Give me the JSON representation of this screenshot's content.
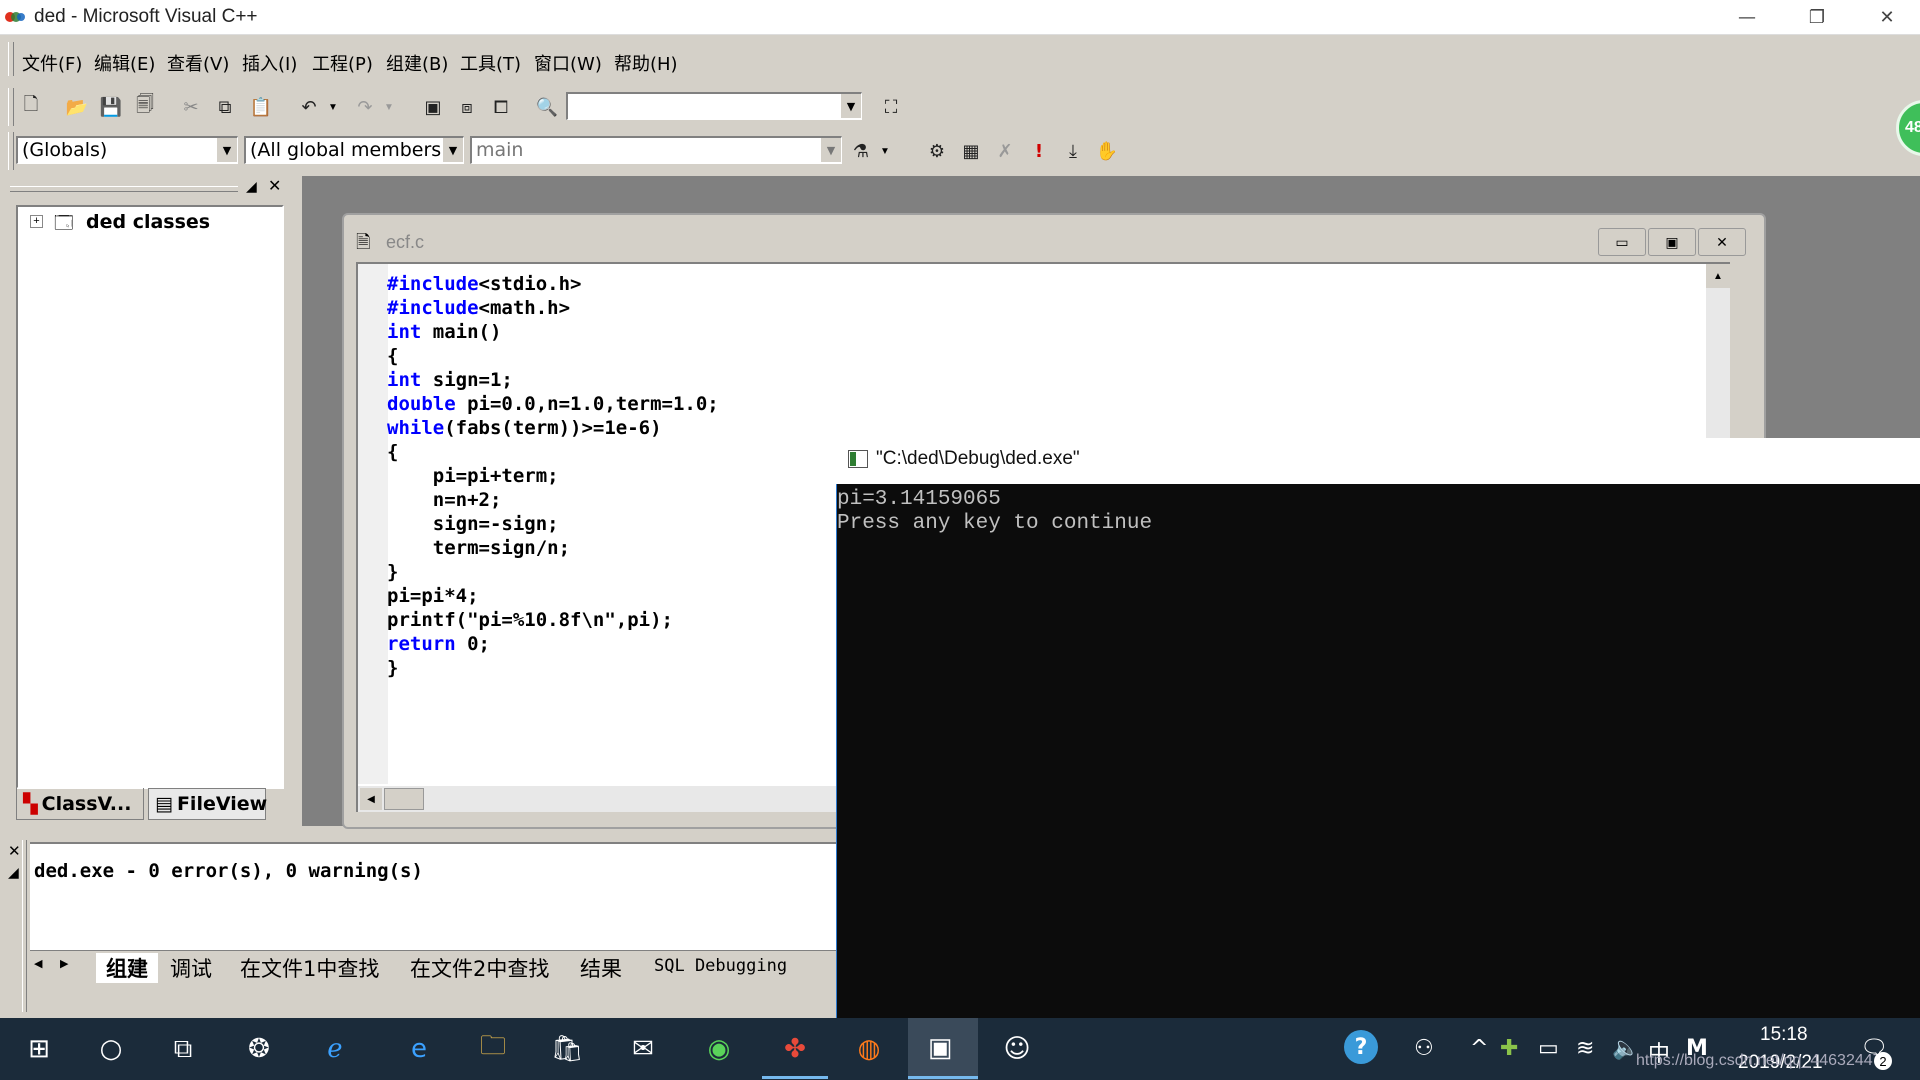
{
  "window": {
    "title": "ded - Microsoft Visual C++",
    "minimize_icon": "—",
    "restore_icon": "❐",
    "close_icon": "✕"
  },
  "menu": [
    "文件(F)",
    "编辑(E)",
    "查看(V)",
    "插入(I)",
    "工程(P)",
    "组建(B)",
    "工具(T)",
    "窗口(W)",
    "帮助(H)"
  ],
  "toolbar": {
    "find_combo_value": "",
    "scope_combo": "(Globals)",
    "members_combo": "(All global members",
    "function_combo": "main"
  },
  "workspace": {
    "tree_root": "ded classes",
    "tabs": [
      "ClassV...",
      "FileView"
    ]
  },
  "editor": {
    "title": "ecf.c",
    "lines": [
      {
        "kw": "#include",
        "rest": "<stdio.h>"
      },
      {
        "kw": "#include",
        "rest": "<math.h>"
      },
      {
        "kw": "int",
        "rest": " main()"
      },
      {
        "kw": "",
        "rest": "{"
      },
      {
        "kw": "int",
        "rest": " sign=1;"
      },
      {
        "kw": "double",
        "rest": " pi=0.0,n=1.0,term=1.0;"
      },
      {
        "kw": "while",
        "rest": "(fabs(term))>=1e-6)"
      },
      {
        "kw": "",
        "rest": "{"
      },
      {
        "kw": "",
        "rest": "    pi=pi+term;"
      },
      {
        "kw": "",
        "rest": "    n=n+2;"
      },
      {
        "kw": "",
        "rest": "    sign=-sign;"
      },
      {
        "kw": "",
        "rest": "    term=sign/n;"
      },
      {
        "kw": "",
        "rest": "}"
      },
      {
        "kw": "",
        "rest": "pi=pi*4;"
      },
      {
        "kw": "",
        "rest": "printf(\"pi=%10.8f\\n\",pi);"
      },
      {
        "kw": "return",
        "rest": " 0;"
      },
      {
        "kw": "",
        "rest": "}"
      }
    ]
  },
  "console": {
    "title": "\"C:\\ded\\Debug\\ded.exe\"",
    "lines": [
      "pi=3.14159065",
      "Press any key to continue"
    ]
  },
  "output": {
    "text": "ded.exe - 0 error(s), 0 warning(s)",
    "tabs": [
      "组建",
      "调试",
      "在文件1中查找",
      "在文件2中查找",
      "结果",
      "SQL Debugging"
    ]
  },
  "taskbar": {
    "time": "15:18",
    "date": "2019/2/21",
    "ime": "中",
    "watermark": "https://blog.csdn.net/qq_44632447",
    "notification_count": "2",
    "badge": "48"
  },
  "colors": {
    "keyword": "#0000ff",
    "taskbar": "#1b2b3a",
    "console_bg": "#0c0c0c",
    "chrome": "#d4d0c8"
  }
}
